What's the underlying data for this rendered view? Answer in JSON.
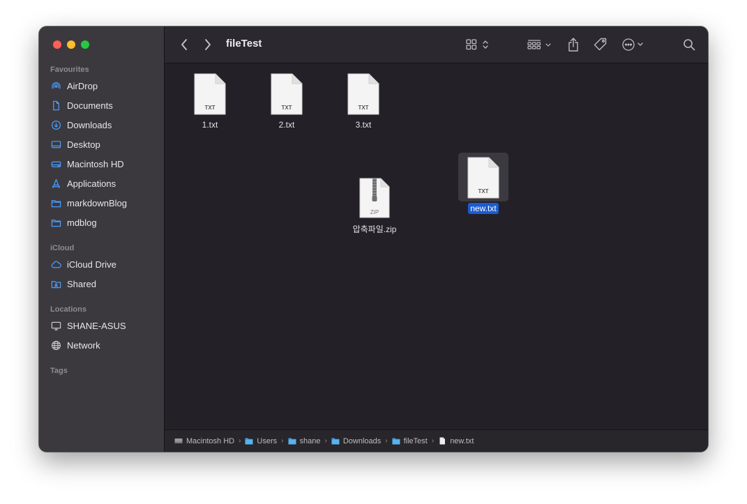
{
  "window": {
    "title": "fileTest"
  },
  "sidebar": {
    "favourites_label": "Favourites",
    "favourites": [
      {
        "label": "AirDrop",
        "icon": "airdrop-icon"
      },
      {
        "label": "Documents",
        "icon": "document-icon"
      },
      {
        "label": "Downloads",
        "icon": "download-icon"
      },
      {
        "label": "Desktop",
        "icon": "desktop-icon"
      },
      {
        "label": "Macintosh HD",
        "icon": "disk-icon"
      },
      {
        "label": "Applications",
        "icon": "applications-icon"
      },
      {
        "label": "markdownBlog",
        "icon": "folder-icon"
      },
      {
        "label": "mdblog",
        "icon": "folder-icon"
      }
    ],
    "icloud_label": "iCloud",
    "icloud": [
      {
        "label": "iCloud Drive",
        "icon": "cloud-icon"
      },
      {
        "label": "Shared",
        "icon": "shared-folder-icon"
      }
    ],
    "locations_label": "Locations",
    "locations": [
      {
        "label": "SHANE-ASUS",
        "icon": "monitor-icon"
      },
      {
        "label": "Network",
        "icon": "globe-icon"
      }
    ],
    "tags_label": "Tags"
  },
  "files": [
    {
      "name": "1.txt",
      "type": "TXT"
    },
    {
      "name": "2.txt",
      "type": "TXT"
    },
    {
      "name": "3.txt",
      "type": "TXT"
    },
    {
      "name": "압축파일.zip",
      "type": "ZIP"
    },
    {
      "name": "new.txt",
      "type": "TXT",
      "selected": true
    }
  ],
  "pathbar": [
    {
      "label": "Macintosh HD",
      "icon": "disk-icon"
    },
    {
      "label": "Users",
      "icon": "folder-icon"
    },
    {
      "label": "shane",
      "icon": "folder-icon"
    },
    {
      "label": "Downloads",
      "icon": "folder-icon"
    },
    {
      "label": "fileTest",
      "icon": "folder-icon"
    },
    {
      "label": "new.txt",
      "icon": "file-icon"
    }
  ],
  "colors": {
    "accent": "#1c5cd1",
    "folder": "#3a9fe3",
    "sidebar_icon": "#4a9eff"
  }
}
